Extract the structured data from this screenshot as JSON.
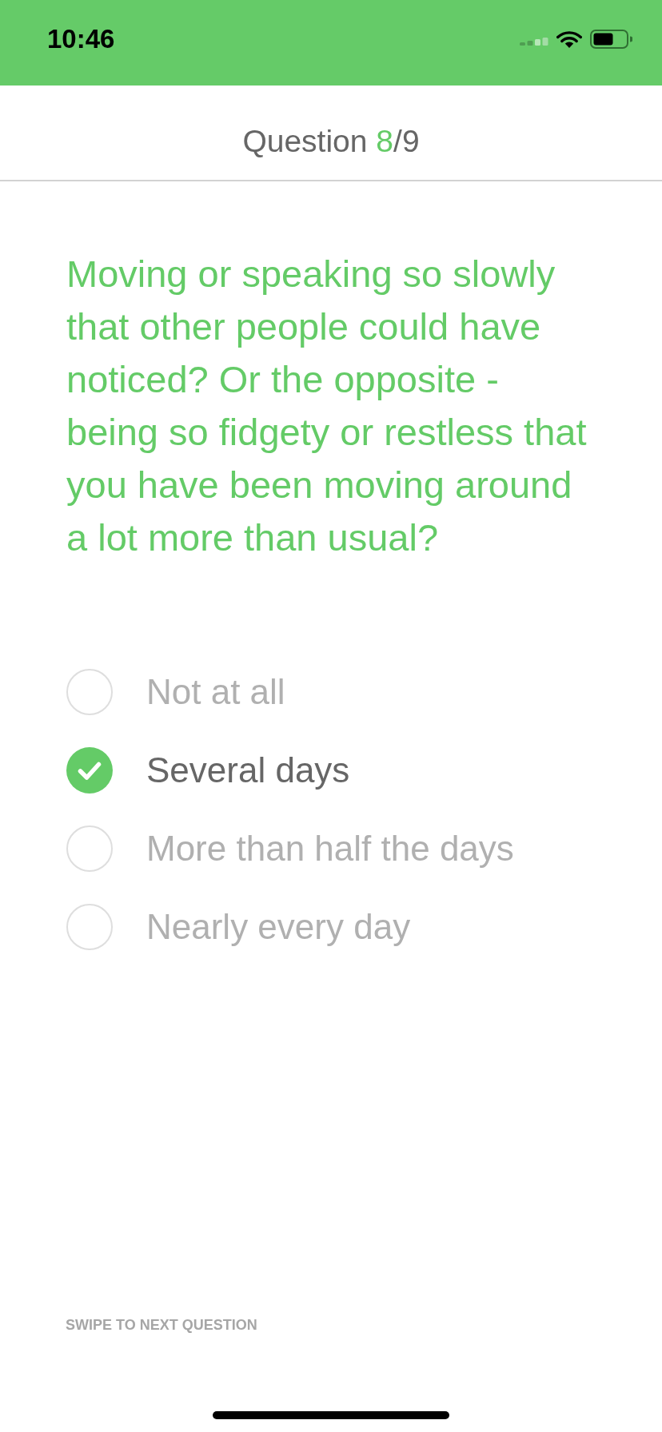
{
  "status_bar": {
    "time": "10:46"
  },
  "header": {
    "title": "Question",
    "current": "8",
    "separator": "/",
    "total": "9"
  },
  "question": "Moving or speaking so slowly that other people could have noticed? Or the opposite - being so fidgety or restless that you have been moving around a lot more than usual?",
  "options": [
    {
      "label": "Not at all",
      "selected": false
    },
    {
      "label": "Several days",
      "selected": true
    },
    {
      "label": "More than half the days",
      "selected": false
    },
    {
      "label": "Nearly every day",
      "selected": false
    }
  ],
  "footer": {
    "hint": "SWIPE TO NEXT QUESTION"
  }
}
